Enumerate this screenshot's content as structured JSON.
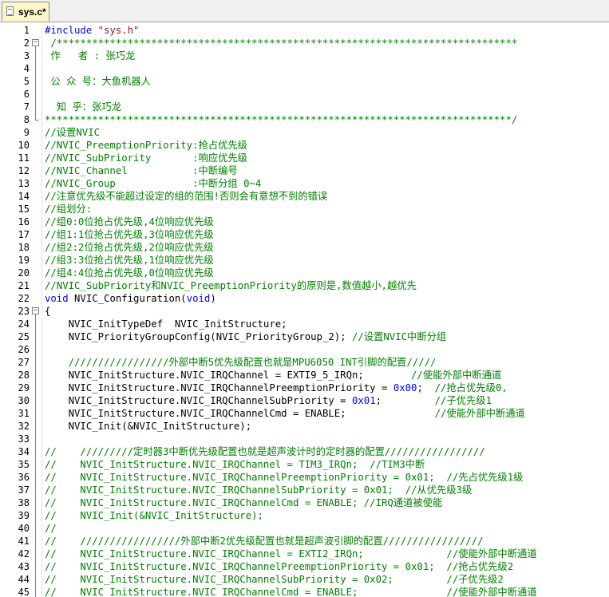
{
  "tab": {
    "title": "sys.c*"
  },
  "lines": [
    {
      "n": "1",
      "parts": [
        {
          "t": "#include ",
          "c": "k"
        },
        {
          "t": "\"sys.h\"",
          "c": "s"
        }
      ]
    },
    {
      "n": "2",
      "parts": [
        {
          "t": " /******************************************************************************",
          "c": "c"
        }
      ]
    },
    {
      "n": "3",
      "parts": [
        {
          "t": " 作   者 : 张巧龙",
          "c": "c"
        }
      ]
    },
    {
      "n": "4",
      "parts": []
    },
    {
      "n": "5",
      "parts": [
        {
          "t": " 公 众 号：大鱼机器人",
          "c": "c"
        }
      ]
    },
    {
      "n": "6",
      "parts": []
    },
    {
      "n": "7",
      "parts": [
        {
          "t": "  知 乎：张巧龙",
          "c": "c"
        }
      ]
    },
    {
      "n": "8",
      "parts": [
        {
          "t": "*******************************************************************************/",
          "c": "c"
        }
      ]
    },
    {
      "n": "9",
      "parts": [
        {
          "t": "//设置NVIC",
          "c": "c"
        }
      ]
    },
    {
      "n": "10",
      "parts": [
        {
          "t": "//NVIC_PreemptionPriority:抢占优先级",
          "c": "c"
        }
      ]
    },
    {
      "n": "11",
      "parts": [
        {
          "t": "//NVIC_SubPriority       :响应优先级",
          "c": "c"
        }
      ]
    },
    {
      "n": "12",
      "parts": [
        {
          "t": "//NVIC_Channel           :中断编号",
          "c": "c"
        }
      ]
    },
    {
      "n": "13",
      "parts": [
        {
          "t": "//NVIC_Group             :中断分组 0~4",
          "c": "c"
        }
      ]
    },
    {
      "n": "14",
      "parts": [
        {
          "t": "//注意优先级不能超过设定的组的范围!否则会有意想不到的错误",
          "c": "c"
        }
      ]
    },
    {
      "n": "15",
      "parts": [
        {
          "t": "//组划分:",
          "c": "c"
        }
      ]
    },
    {
      "n": "16",
      "parts": [
        {
          "t": "//组0:0位抢占优先级,4位响应优先级",
          "c": "c"
        }
      ]
    },
    {
      "n": "17",
      "parts": [
        {
          "t": "//组1:1位抢占优先级,3位响应优先级",
          "c": "c"
        }
      ]
    },
    {
      "n": "18",
      "parts": [
        {
          "t": "//组2:2位抢占优先级,2位响应优先级",
          "c": "c"
        }
      ]
    },
    {
      "n": "19",
      "parts": [
        {
          "t": "//组3:3位抢占优先级,1位响应优先级",
          "c": "c"
        }
      ]
    },
    {
      "n": "20",
      "parts": [
        {
          "t": "//组4:4位抢占优先级,0位响应优先级",
          "c": "c"
        }
      ]
    },
    {
      "n": "21",
      "parts": [
        {
          "t": "//NVIC_SubPriority和NVIC_PreemptionPriority的原则是,数值越小,越优先",
          "c": "c"
        }
      ]
    },
    {
      "n": "22",
      "parts": [
        {
          "t": "void",
          "c": "k"
        },
        {
          "t": " NVIC_Configuration(",
          "c": ""
        },
        {
          "t": "void",
          "c": "k"
        },
        {
          "t": ")",
          "c": ""
        }
      ]
    },
    {
      "n": "23",
      "parts": [
        {
          "t": "{",
          "c": ""
        }
      ]
    },
    {
      "n": "24",
      "parts": [
        {
          "t": "    NVIC_InitTypeDef  NVIC_InitStructure;",
          "c": ""
        }
      ]
    },
    {
      "n": "25",
      "parts": [
        {
          "t": "    NVIC_PriorityGroupConfig(NVIC_PriorityGroup_2); ",
          "c": ""
        },
        {
          "t": "//设置NVIC中断分组",
          "c": "c"
        }
      ]
    },
    {
      "n": "26",
      "parts": []
    },
    {
      "n": "27",
      "parts": [
        {
          "t": "    /////////////////外部中断5优先级配置也就是MPU6050 INT引脚的配置/////",
          "c": "c"
        }
      ]
    },
    {
      "n": "28",
      "parts": [
        {
          "t": "    NVIC_InitStructure.NVIC_IRQChannel = EXTI9_5_IRQn;        ",
          "c": ""
        },
        {
          "t": "//使能外部中断通道",
          "c": "c"
        }
      ]
    },
    {
      "n": "29",
      "parts": [
        {
          "t": "    NVIC_InitStructure.NVIC_IRQChannelPreemptionPriority = ",
          "c": ""
        },
        {
          "t": "0x00",
          "c": "n"
        },
        {
          "t": ";  ",
          "c": ""
        },
        {
          "t": "//抢占优先级0,",
          "c": "c"
        }
      ]
    },
    {
      "n": "30",
      "parts": [
        {
          "t": "    NVIC_InitStructure.NVIC_IRQChannelSubPriority = ",
          "c": ""
        },
        {
          "t": "0x01",
          "c": "n"
        },
        {
          "t": ";         ",
          "c": ""
        },
        {
          "t": "//子优先级1",
          "c": "c"
        }
      ]
    },
    {
      "n": "31",
      "parts": [
        {
          "t": "    NVIC_InitStructure.NVIC_IRQChannelCmd = ENABLE;               ",
          "c": ""
        },
        {
          "t": "//使能外部中断通道",
          "c": "c"
        }
      ]
    },
    {
      "n": "32",
      "parts": [
        {
          "t": "    NVIC_Init(&NVIC_InitStructure);",
          "c": ""
        }
      ]
    },
    {
      "n": "33",
      "parts": []
    },
    {
      "n": "34",
      "parts": [
        {
          "t": "//    /////////定时器3中断优先级配置也就是超声波计时的定时器的配置/////////////////",
          "c": "c"
        }
      ]
    },
    {
      "n": "35",
      "parts": [
        {
          "t": "//    NVIC_InitStructure.NVIC_IRQChannel = TIM3_IRQn;  //TIM3中断",
          "c": "c"
        }
      ]
    },
    {
      "n": "36",
      "parts": [
        {
          "t": "//    NVIC_InitStructure.NVIC_IRQChannelPreemptionPriority = 0x01;  //先占优先级1级",
          "c": "c"
        }
      ]
    },
    {
      "n": "37",
      "parts": [
        {
          "t": "//    NVIC_InitStructure.NVIC_IRQChannelSubPriority = 0x01;  //从优先级3级",
          "c": "c"
        }
      ]
    },
    {
      "n": "38",
      "parts": [
        {
          "t": "//    NVIC_InitStructure.NVIC_IRQChannelCmd = ENABLE; //IRQ通道被使能",
          "c": "c"
        }
      ]
    },
    {
      "n": "39",
      "parts": [
        {
          "t": "//    NVIC_Init(&NVIC_InitStructure);",
          "c": "c"
        }
      ]
    },
    {
      "n": "40",
      "parts": [
        {
          "t": "//",
          "c": "c"
        }
      ]
    },
    {
      "n": "41",
      "parts": [
        {
          "t": "//    /////////////////外部中断2优先级配置也就是超声波引脚的配置/////////////////",
          "c": "c"
        }
      ]
    },
    {
      "n": "42",
      "parts": [
        {
          "t": "//    NVIC_InitStructure.NVIC_IRQChannel = EXTI2_IRQn;              //使能外部中断通道",
          "c": "c"
        }
      ]
    },
    {
      "n": "43",
      "parts": [
        {
          "t": "//    NVIC_InitStructure.NVIC_IRQChannelPreemptionPriority = 0x01;  //抢占优先级2",
          "c": "c"
        }
      ]
    },
    {
      "n": "44",
      "parts": [
        {
          "t": "//    NVIC_InitStructure.NVIC_IRQChannelSubPriority = 0x02;         //子优先级2",
          "c": "c"
        }
      ]
    },
    {
      "n": "45",
      "parts": [
        {
          "t": "//    NVIC_InitStructure.NVIC_IRQChannelCmd = ENABLE;               //使能外部中断通道",
          "c": "c"
        }
      ]
    }
  ]
}
